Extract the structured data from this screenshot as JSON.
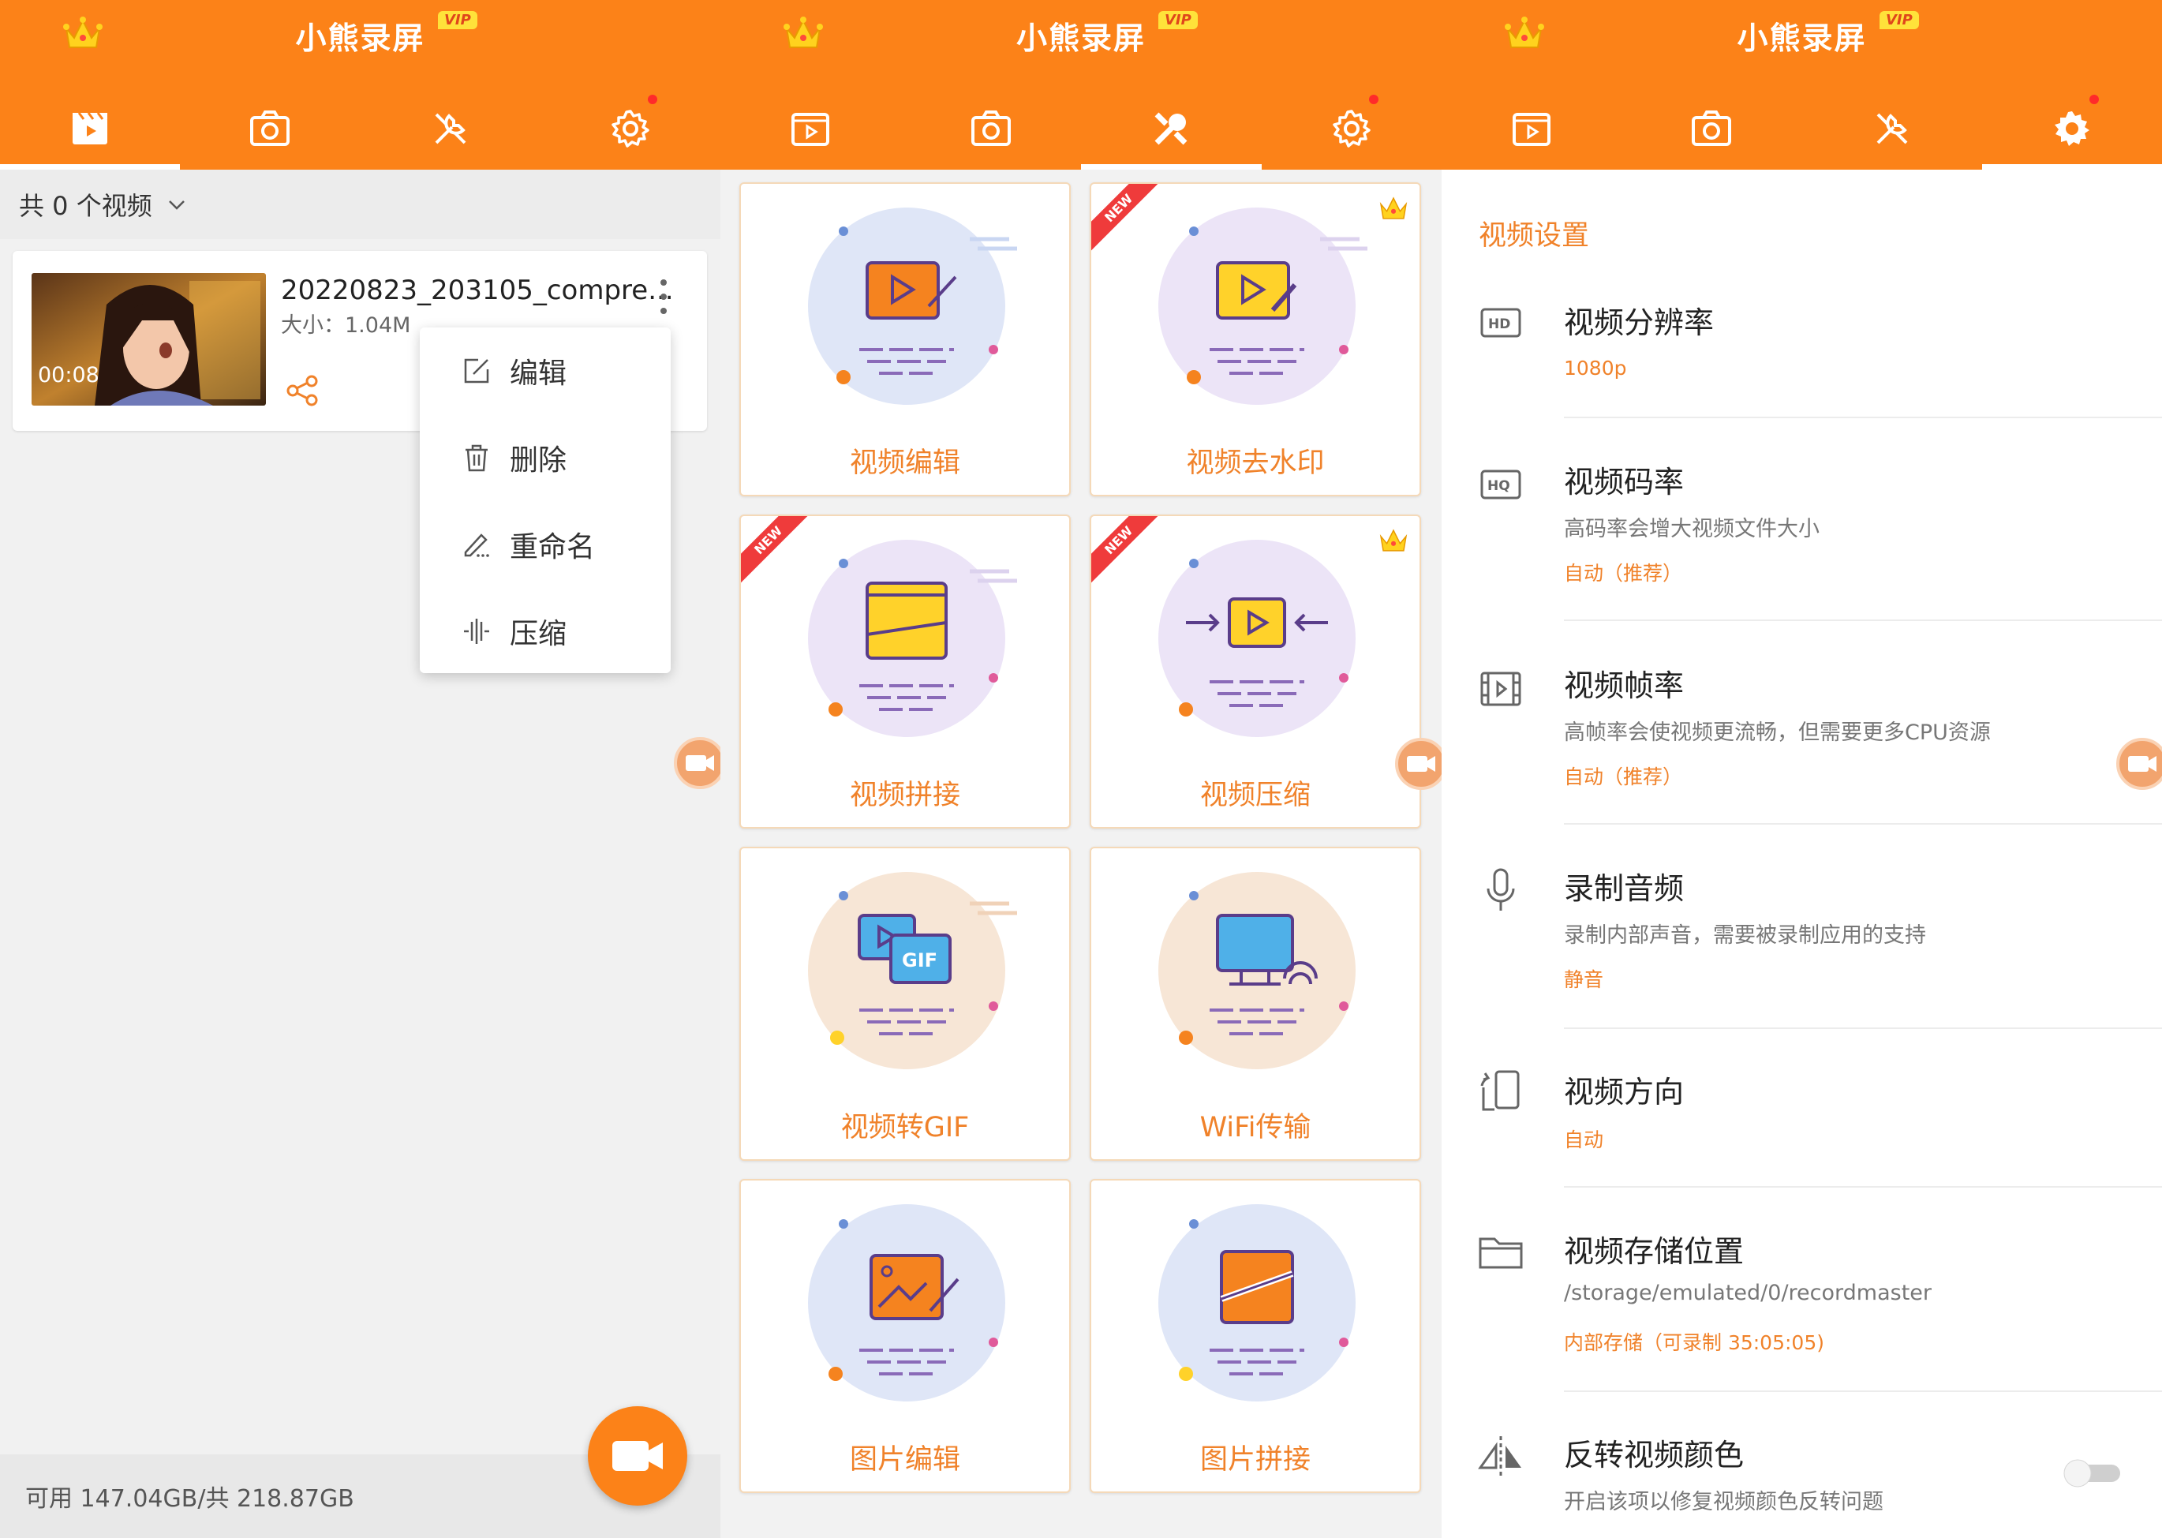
{
  "app": {
    "title": "小熊录屏",
    "vip_badge": "VIP"
  },
  "colors": {
    "accent": "#fc8218",
    "label": "#f0822a",
    "new_ribbon": "#ef3b3b"
  },
  "tabs": [
    {
      "name": "videos",
      "icon": "video-list-icon"
    },
    {
      "name": "screenshots",
      "icon": "camera-icon"
    },
    {
      "name": "tools",
      "icon": "tools-icon"
    },
    {
      "name": "settings",
      "icon": "gear-icon",
      "has_notification_dot": true
    }
  ],
  "panel1": {
    "count_label": "共 0 个视频",
    "video": {
      "filename": "20220823_203105_compre...",
      "size": "大小：1.04M",
      "duration": "00:08"
    },
    "menu": [
      {
        "label": "编辑",
        "icon": "edit-icon"
      },
      {
        "label": "删除",
        "icon": "trash-icon"
      },
      {
        "label": "重命名",
        "icon": "rename-icon"
      },
      {
        "label": "压缩",
        "icon": "compress-icon"
      }
    ],
    "storage": "可用 147.04GB/共 218.87GB"
  },
  "panel2": {
    "tools": [
      {
        "label": "视频编辑",
        "new": false,
        "vip": false
      },
      {
        "label": "视频去水印",
        "new": true,
        "vip": true
      },
      {
        "label": "视频拼接",
        "new": true,
        "vip": false
      },
      {
        "label": "视频压缩",
        "new": true,
        "vip": true
      },
      {
        "label": "视频转GIF",
        "new": false,
        "vip": false
      },
      {
        "label": "WiFi传输",
        "new": false,
        "vip": false
      },
      {
        "label": "图片编辑",
        "new": false,
        "vip": false
      },
      {
        "label": "图片拼接",
        "new": false,
        "vip": false
      }
    ],
    "new_label": "NEW"
  },
  "panel3": {
    "section_title": "视频设置",
    "settings": [
      {
        "title": "视频分辨率",
        "desc": "",
        "value": "1080p",
        "icon": "hd-icon"
      },
      {
        "title": "视频码率",
        "desc": "高码率会增大视频文件大小",
        "value": "自动（推荐）",
        "icon": "hq-icon"
      },
      {
        "title": "视频帧率",
        "desc": "高帧率会使视频更流畅，但需要更多CPU资源",
        "value": "自动（推荐）",
        "icon": "film-icon"
      },
      {
        "title": "录制音频",
        "desc": "录制内部声音，需要被录制应用的支持",
        "value": "静音",
        "icon": "microphone-icon"
      },
      {
        "title": "视频方向",
        "desc": "",
        "value": "自动",
        "icon": "rotate-phone-icon"
      },
      {
        "title": "视频存储位置",
        "desc": "/storage/emulated/0/recordmaster",
        "value": "内部存储（可录制 35:05:05)",
        "icon": "folder-icon"
      },
      {
        "title": "反转视频颜色",
        "desc": "开启该项以修复视频颜色反转问题",
        "value": "",
        "icon": "flip-icon",
        "toggle": false
      }
    ],
    "hd_text": "HD",
    "hq_text": "HQ"
  }
}
